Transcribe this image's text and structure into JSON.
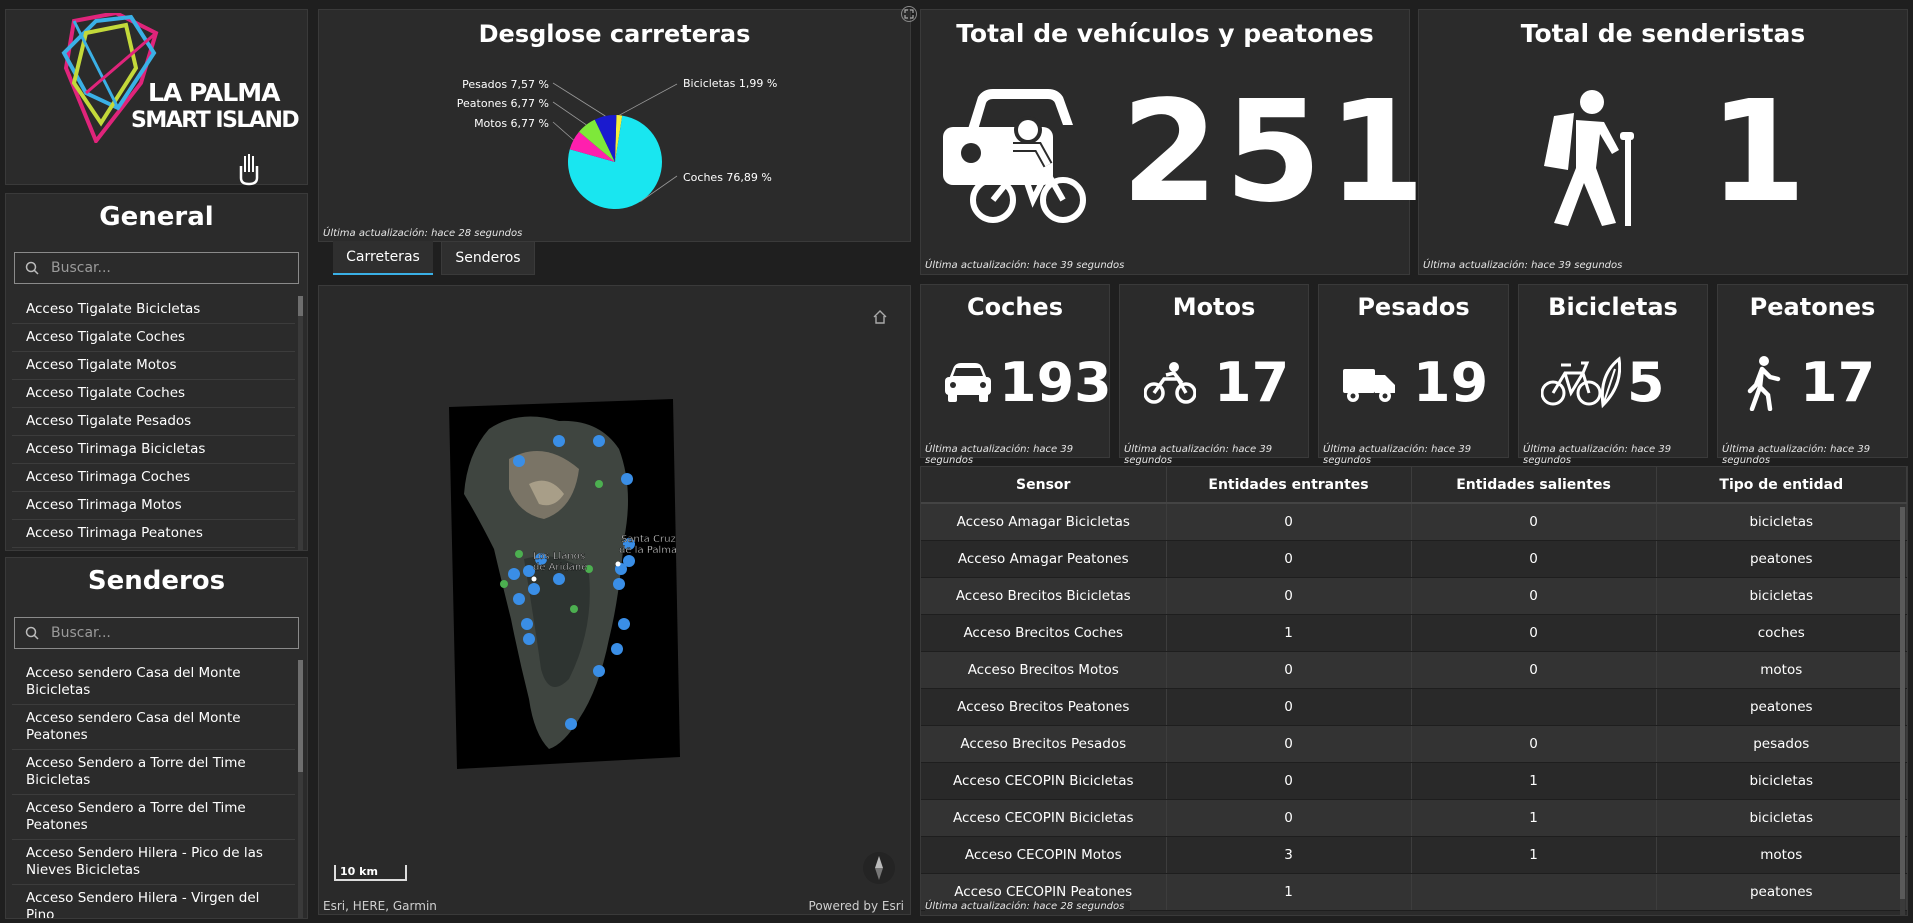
{
  "logo": {
    "line1": "LA PALMA",
    "line2": "SMART ISLAND"
  },
  "general": {
    "title": "General",
    "search_placeholder": "Buscar...",
    "items": [
      "Acceso Tigalate Bicicletas",
      "Acceso Tigalate Coches",
      "Acceso Tigalate Motos",
      "Acceso Tigalate Coches",
      "Acceso Tigalate Pesados",
      "Acceso Tirimaga Bicicletas",
      "Acceso Tirimaga Coches",
      "Acceso Tirimaga Motos",
      "Acceso Tirimaga Peatones"
    ]
  },
  "senderos": {
    "title": "Senderos",
    "search_placeholder": "Buscar...",
    "items": [
      "Acceso sendero Casa del Monte Bicicletas",
      "Acceso sendero Casa del Monte Peatones",
      "Acceso Sendero a Torre del Time Bicicletas",
      "Acceso Sendero a Torre del Time Peatones",
      "Acceso Sendero Hilera - Pico de las Nieves Bicicletas",
      "Acceso Sendero Hilera - Virgen del Pino"
    ]
  },
  "pie": {
    "title": "Desglose carreteras",
    "footnote": "Última actualización: hace 28 segundos"
  },
  "chart_data": {
    "type": "pie",
    "title": "Desglose carreteras",
    "slices": [
      {
        "label": "Coches",
        "value": 76.89,
        "text": "Coches 76,89 %",
        "color": "#19e6f0"
      },
      {
        "label": "Motos",
        "value": 6.77,
        "text": "Motos 6,77 %",
        "color": "#ff1fae"
      },
      {
        "label": "Peatones",
        "value": 6.77,
        "text": "Peatones 6,77 %",
        "color": "#7ee83a"
      },
      {
        "label": "Pesados",
        "value": 7.57,
        "text": "Pesados 7,57 %",
        "color": "#1a1acf"
      },
      {
        "label": "Bicicletas",
        "value": 1.99,
        "text": "Bicicletas 1,99 %",
        "color": "#f4ee3a"
      }
    ]
  },
  "tabs": {
    "carreteras": "Carreteras",
    "senderos": "Senderos"
  },
  "map": {
    "label_llanos_1": "Los Llanos",
    "label_llanos_2": "de Aridane",
    "label_santa_1": "Santa Cruz",
    "label_santa_2": "de la Palma",
    "scale": "10 km",
    "attribution": "Esri, HERE, Garmin",
    "powered": "Powered by Esri"
  },
  "total_vehicles": {
    "title": "Total de vehículos y peatones",
    "value": "251",
    "footnote": "Última actualización: hace 39 segundos"
  },
  "total_hikers": {
    "title": "Total de senderistas",
    "value": "1",
    "footnote": "Última actualización: hace 39 segundos"
  },
  "kpis": [
    {
      "title": "Coches",
      "value": "193",
      "icon": "car-icon",
      "footnote": "Última actualización: hace 39 segundos"
    },
    {
      "title": "Motos",
      "value": "17",
      "icon": "motorbike-icon",
      "footnote": "Última actualización: hace 39 segundos"
    },
    {
      "title": "Pesados",
      "value": "19",
      "icon": "truck-icon",
      "footnote": "Última actualización: hace 39 segundos"
    },
    {
      "title": "Bicicletas",
      "value": "5",
      "icon": "bicycle-icon",
      "footnote": "Última actualización: hace 39 segundos"
    },
    {
      "title": "Peatones",
      "value": "17",
      "icon": "pedestrian-icon",
      "footnote": "Última actualización: hace 39 segundos"
    }
  ],
  "table": {
    "headers": [
      "Sensor",
      "Entidades entrantes",
      "Entidades salientes",
      "Tipo de entidad"
    ],
    "rows": [
      [
        "Acceso Amagar Bicicletas",
        "0",
        "0",
        "bicicletas"
      ],
      [
        "Acceso Amagar Peatones",
        "0",
        "0",
        "peatones"
      ],
      [
        "Acceso Brecitos Bicicletas",
        "0",
        "0",
        "bicicletas"
      ],
      [
        "Acceso Brecitos Coches",
        "1",
        "0",
        "coches"
      ],
      [
        "Acceso Brecitos Motos",
        "0",
        "0",
        "motos"
      ],
      [
        "Acceso Brecitos Peatones",
        "0",
        "",
        "peatones"
      ],
      [
        "Acceso Brecitos Pesados",
        "0",
        "0",
        "pesados"
      ],
      [
        "Acceso CECOPIN Bicicletas",
        "0",
        "1",
        "bicicletas"
      ],
      [
        "Acceso CECOPIN Bicicletas",
        "0",
        "1",
        "bicicletas"
      ],
      [
        "Acceso CECOPIN Motos",
        "3",
        "1",
        "motos"
      ],
      [
        "Acceso CECOPIN Peatones",
        "1",
        "",
        "peatones"
      ]
    ],
    "footnote": "Última actualización: hace 28 segundos"
  }
}
